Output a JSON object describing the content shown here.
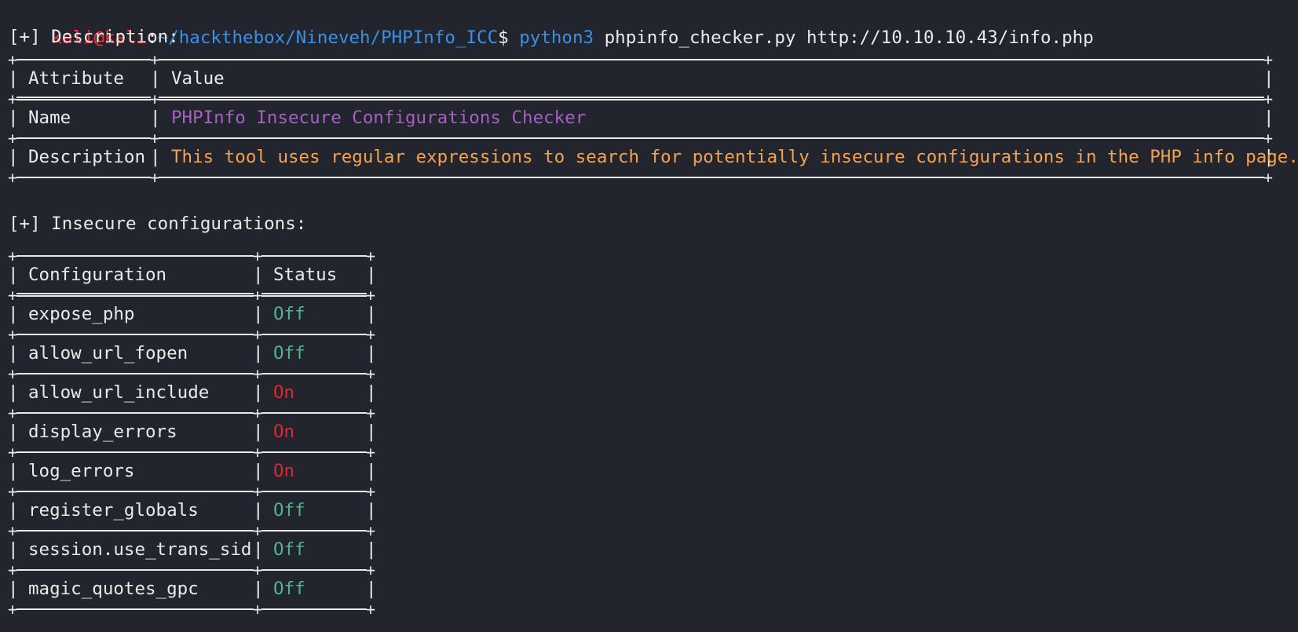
{
  "prompt": {
    "user_host": "kali@kali",
    "sep": ":",
    "path": "~/hackthebox/Nineveh/PHPInfo_ICC",
    "dollar": "$",
    "cmd": "python3",
    "args": " phpinfo_checker.py http://10.10.10.43/info.php"
  },
  "description": {
    "heading": "[+] Description:",
    "col_attr": "Attribute",
    "col_value": "Value",
    "rows": [
      {
        "attr": "Name",
        "value": "PHPInfo Insecure Configurations Checker"
      },
      {
        "attr": "Description",
        "value": "This tool uses regular expressions to search for potentially insecure configurations in the PHP info page."
      }
    ]
  },
  "configs": {
    "heading": "[+] Insecure configurations:",
    "col_config": "Configuration",
    "col_status": "Status",
    "rows": [
      {
        "name": "expose_php",
        "status": "Off"
      },
      {
        "name": "allow_url_fopen",
        "status": "Off"
      },
      {
        "name": "allow_url_include",
        "status": "On"
      },
      {
        "name": "display_errors",
        "status": "On"
      },
      {
        "name": "log_errors",
        "status": "On"
      },
      {
        "name": "register_globals",
        "status": "Off"
      },
      {
        "name": "session.use_trans_sid",
        "status": "Off"
      },
      {
        "name": "magic_quotes_gpc",
        "status": "Off"
      }
    ]
  },
  "colors": {
    "background": "#22252d",
    "on": "#e0262e",
    "off": "#4fb58e",
    "name_value": "#a560c2",
    "description_value": "#f5a24c"
  }
}
